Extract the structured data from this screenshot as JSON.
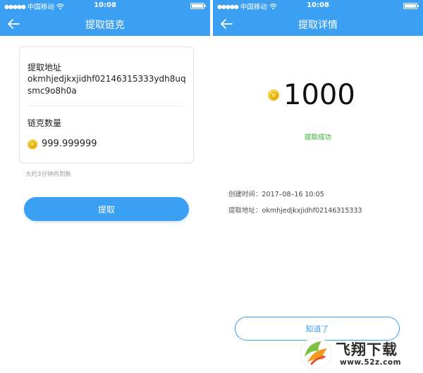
{
  "left_screen": {
    "status_bar": {
      "carrier": "中国移动",
      "time": "10:08"
    },
    "nav": {
      "title": "提取链克"
    },
    "card": {
      "address_label": "提取地址",
      "address_value": "okmhjedjkxjidhf02146315333ydh8uqsmc9o8h0a",
      "quantity_label": "链克数量",
      "quantity_value": "999.999999"
    },
    "hint": "大约3分钟内到账",
    "submit_label": "提取"
  },
  "right_screen": {
    "status_bar": {
      "carrier": "中国移动",
      "time": "10:08"
    },
    "nav": {
      "title": "提取详情"
    },
    "amount": "1000",
    "status_text": "提取成功",
    "details": {
      "created_label": "创建时间：",
      "created_value": "2017–08–16 10:05",
      "address_label": "提取地址：",
      "address_value": "okmhjedjkxjidhf02146315333"
    },
    "ok_label": "知道了"
  },
  "watermark": {
    "name": "飞翔下载",
    "url": "www.52z.com"
  },
  "colors": {
    "primary": "#3b9ff2",
    "success": "#2db22a",
    "coin": "#f4c21b"
  },
  "icons": [
    "back-arrow-icon",
    "wifi-icon",
    "signal-icon",
    "battery-icon",
    "coin-icon"
  ]
}
